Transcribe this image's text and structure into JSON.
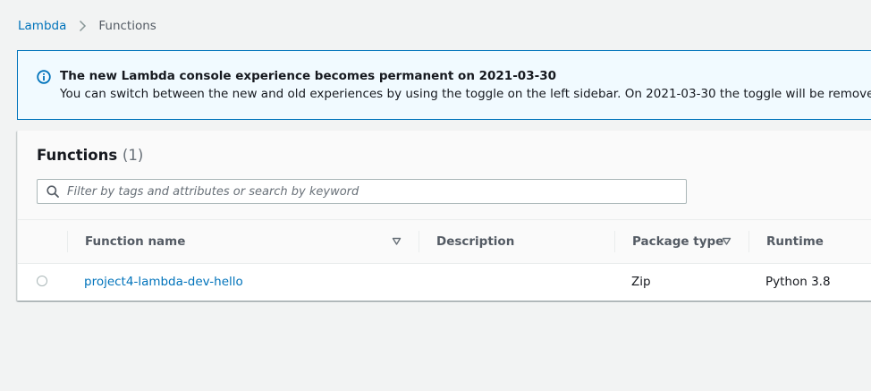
{
  "breadcrumb": {
    "root": "Lambda",
    "current": "Functions"
  },
  "flash": {
    "icon": "info-icon",
    "title": "The new Lambda console experience becomes permanent on 2021-03-30",
    "body": "You can switch between the new and old experiences by using the toggle on the left sidebar. On 2021-03-30 the toggle will be removed and th"
  },
  "functions": {
    "title": "Functions",
    "count": "(1)",
    "search_placeholder": "Filter by tags and attributes or search by keyword"
  },
  "table": {
    "columns": {
      "name": "Function name",
      "description": "Description",
      "package_type": "Package type",
      "runtime": "Runtime"
    },
    "rows": [
      {
        "name": "project4-lambda-dev-hello",
        "description": "",
        "package_type": "Zip",
        "runtime": "Python 3.8"
      }
    ]
  },
  "colors": {
    "link": "#0073bb",
    "flash_border": "#0073bb",
    "flash_bg": "#f1faff",
    "page_bg": "#f2f3f3"
  }
}
